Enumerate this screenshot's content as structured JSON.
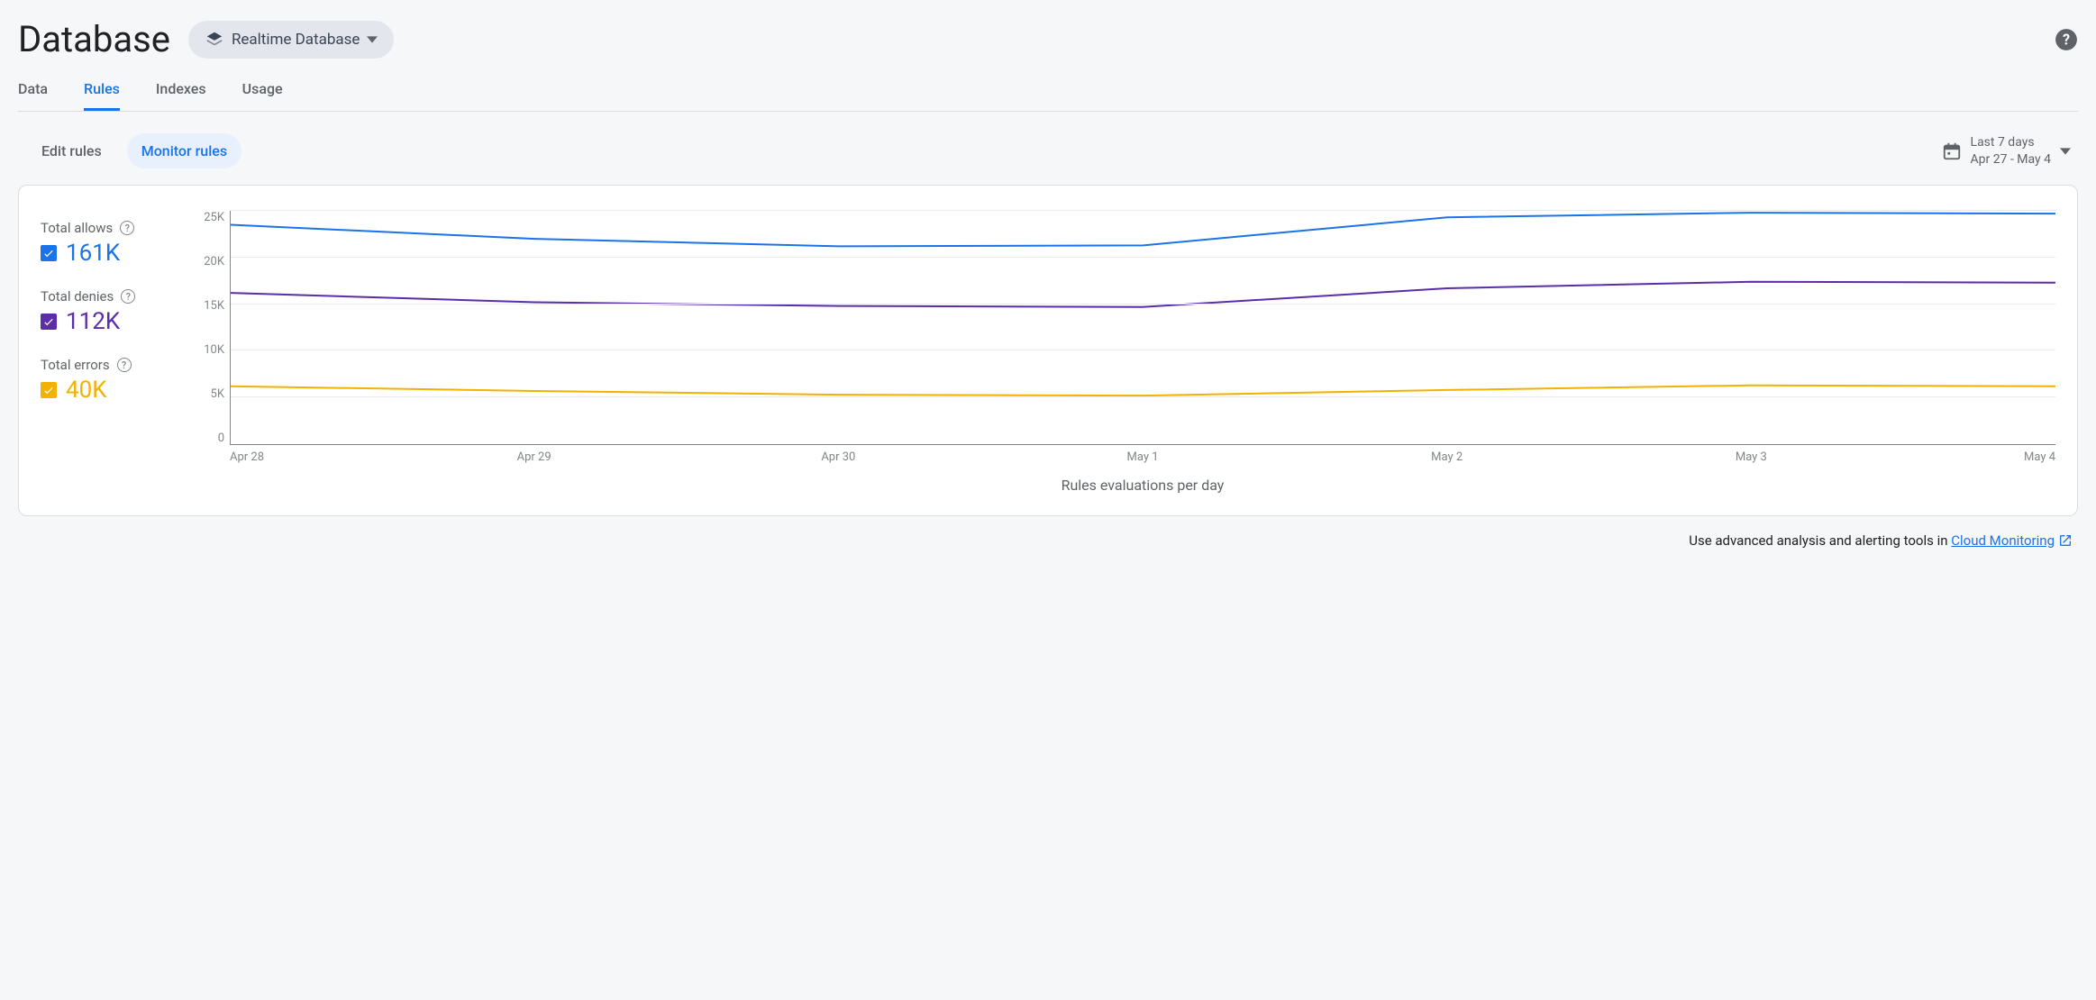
{
  "header": {
    "title": "Database",
    "db_type_label": "Realtime Database"
  },
  "tabs": {
    "data": "Data",
    "rules": "Rules",
    "indexes": "Indexes",
    "usage": "Usage",
    "active": "rules"
  },
  "sub_tabs": {
    "edit": "Edit rules",
    "monitor": "Monitor rules",
    "active": "monitor"
  },
  "date_range": {
    "label": "Last 7 days",
    "range": "Apr 27 - May 4"
  },
  "legend": {
    "allows": {
      "label": "Total allows",
      "value": "161K",
      "color": "#1a73e8"
    },
    "denies": {
      "label": "Total denies",
      "value": "112K",
      "color": "#5b2da8"
    },
    "errors": {
      "label": "Total errors",
      "value": "40K",
      "color": "#f2b200"
    }
  },
  "chart": {
    "xlabel": "Rules evaluations per day"
  },
  "footer": {
    "text": "Use advanced analysis and alerting tools in ",
    "link_label": "Cloud Monitoring"
  },
  "chart_data": {
    "type": "line",
    "title": "Rules evaluations per day",
    "xlabel": "",
    "ylabel": "",
    "ylim": [
      0,
      25000
    ],
    "yticks": [
      0,
      5000,
      10000,
      15000,
      20000,
      25000
    ],
    "ytick_labels": [
      "0",
      "5K",
      "10K",
      "15K",
      "20K",
      "25K"
    ],
    "x": [
      "Apr 28",
      "Apr 29",
      "Apr 30",
      "May 1",
      "May 2",
      "May 3",
      "May 4"
    ],
    "series": [
      {
        "name": "Total allows",
        "color": "#1a73e8",
        "values": [
          23500,
          22000,
          21200,
          21300,
          24300,
          24800,
          24700
        ]
      },
      {
        "name": "Total denies",
        "color": "#5b2da8",
        "values": [
          16200,
          15200,
          14800,
          14700,
          16700,
          17400,
          17300
        ]
      },
      {
        "name": "Total errors",
        "color": "#f2b200",
        "values": [
          6200,
          5700,
          5300,
          5200,
          5800,
          6300,
          6200
        ]
      }
    ]
  }
}
